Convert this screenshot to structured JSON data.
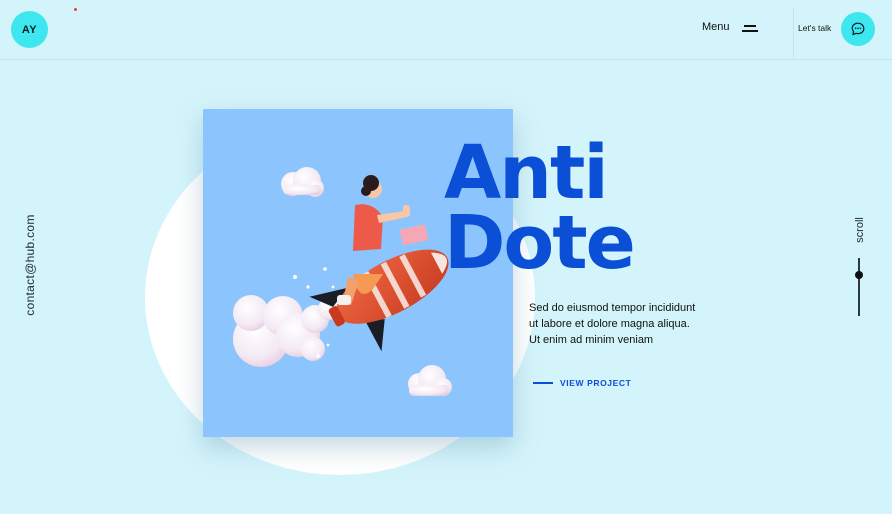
{
  "header": {
    "logo_text": "AY",
    "menu_label": "Menu",
    "talk_label": "Let's talk"
  },
  "hero": {
    "title_line1": "Anti",
    "title_line2": "Dote",
    "description_lines": [
      "Sed do eiusmod tempor incididunt",
      "ut labore et dolore magna aliqua.",
      "Ut enim ad minim veniam"
    ],
    "cta_label": "VIEW PROJECT"
  },
  "side": {
    "email": "contact@hub.com",
    "scroll_label": "scroll"
  },
  "colors": {
    "background": "#d4f4fb",
    "accent_cyan": "#3ee6f0",
    "title_blue": "#0a4fd6",
    "card_blue": "#8cc5fd"
  },
  "icons": {
    "chat": "chat-bubble-icon",
    "menu": "hamburger-icon"
  },
  "illustration": "person-riding-rocket-with-laptop"
}
